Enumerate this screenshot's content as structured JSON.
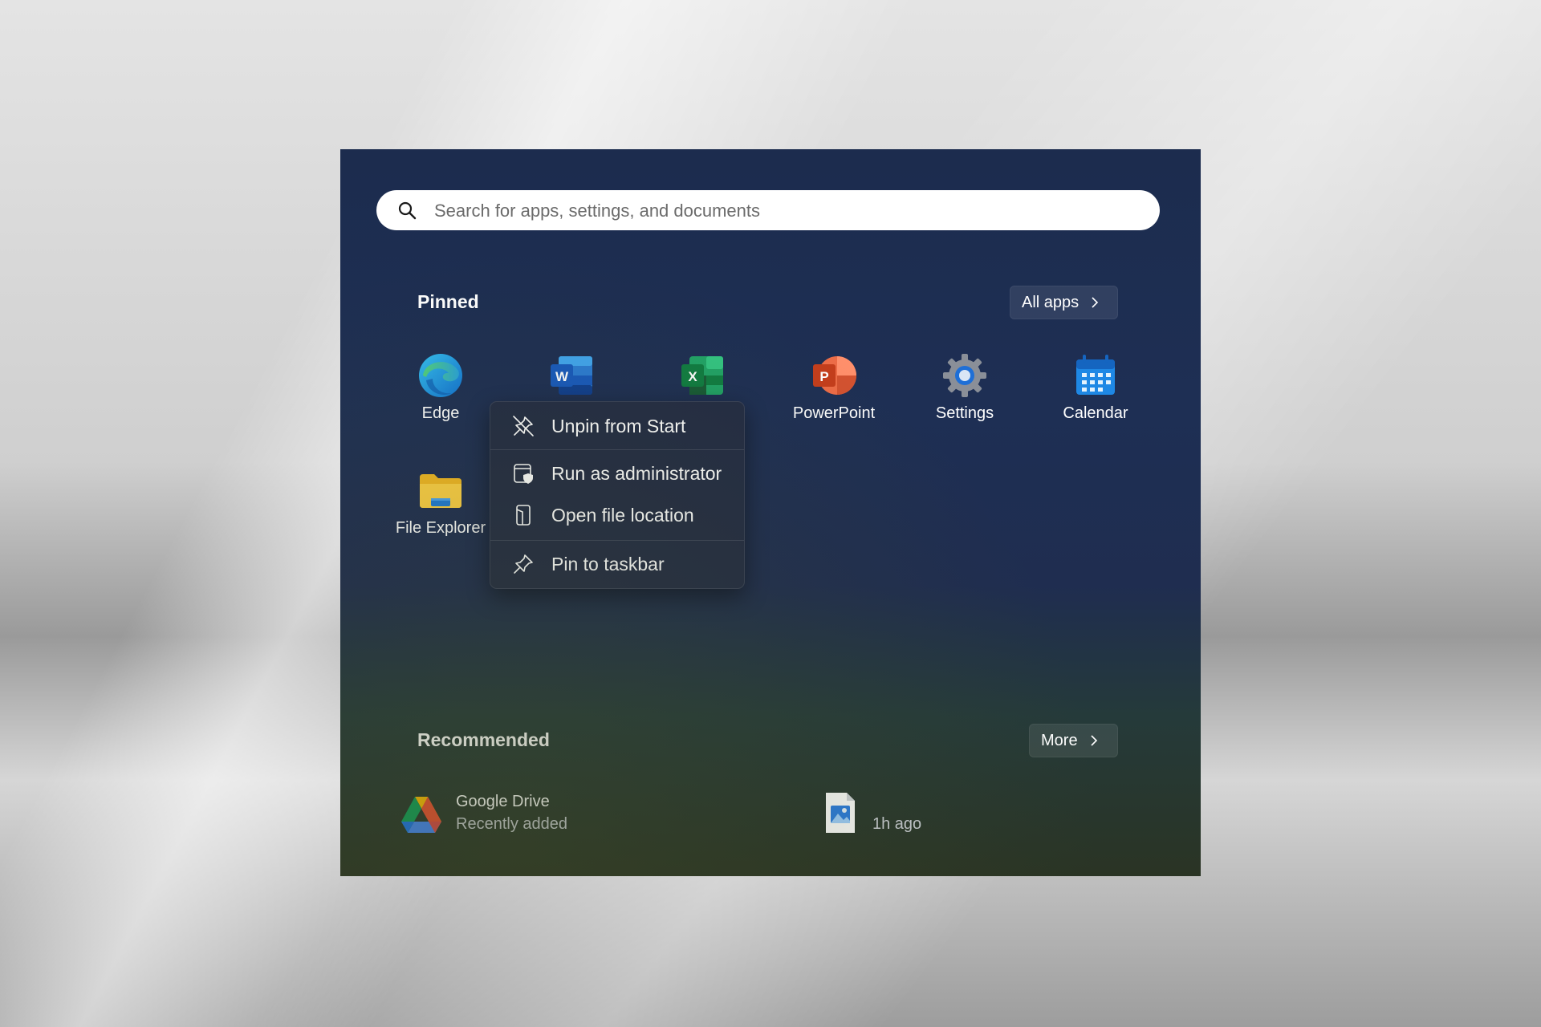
{
  "search": {
    "placeholder": "Search for apps, settings, and documents"
  },
  "pinned": {
    "title": "Pinned",
    "all_apps_label": "All apps",
    "apps": [
      {
        "label": "Edge",
        "icon": "edge-icon"
      },
      {
        "label": "",
        "icon": "word-icon"
      },
      {
        "label": "",
        "icon": "excel-icon"
      },
      {
        "label": "PowerPoint",
        "icon": "powerpoint-icon"
      },
      {
        "label": "Settings",
        "icon": "gear-icon"
      },
      {
        "label": "Calendar",
        "icon": "calendar-icon"
      },
      {
        "label": "File Explorer",
        "icon": "folder-icon"
      }
    ]
  },
  "context_menu": {
    "items": [
      {
        "label": "Unpin from Start",
        "icon": "unpin-icon"
      },
      {
        "label": "Run as administrator",
        "icon": "shield-window-icon"
      },
      {
        "label": "Open file location",
        "icon": "file-location-icon"
      },
      {
        "label": "Pin to taskbar",
        "icon": "pin-icon"
      }
    ]
  },
  "recommended": {
    "title": "Recommended",
    "more_label": "More",
    "items": [
      {
        "title": "Google Drive",
        "subtitle": "Recently added",
        "icon": "google-drive-icon"
      },
      {
        "title": "",
        "subtitle": "1h ago",
        "icon": "image-file-icon"
      }
    ]
  },
  "colors": {
    "panel_top": "#1c2c4e",
    "panel_bottom": "#2a3424",
    "menu_bg": "#232c44",
    "text": "#ffffff"
  }
}
